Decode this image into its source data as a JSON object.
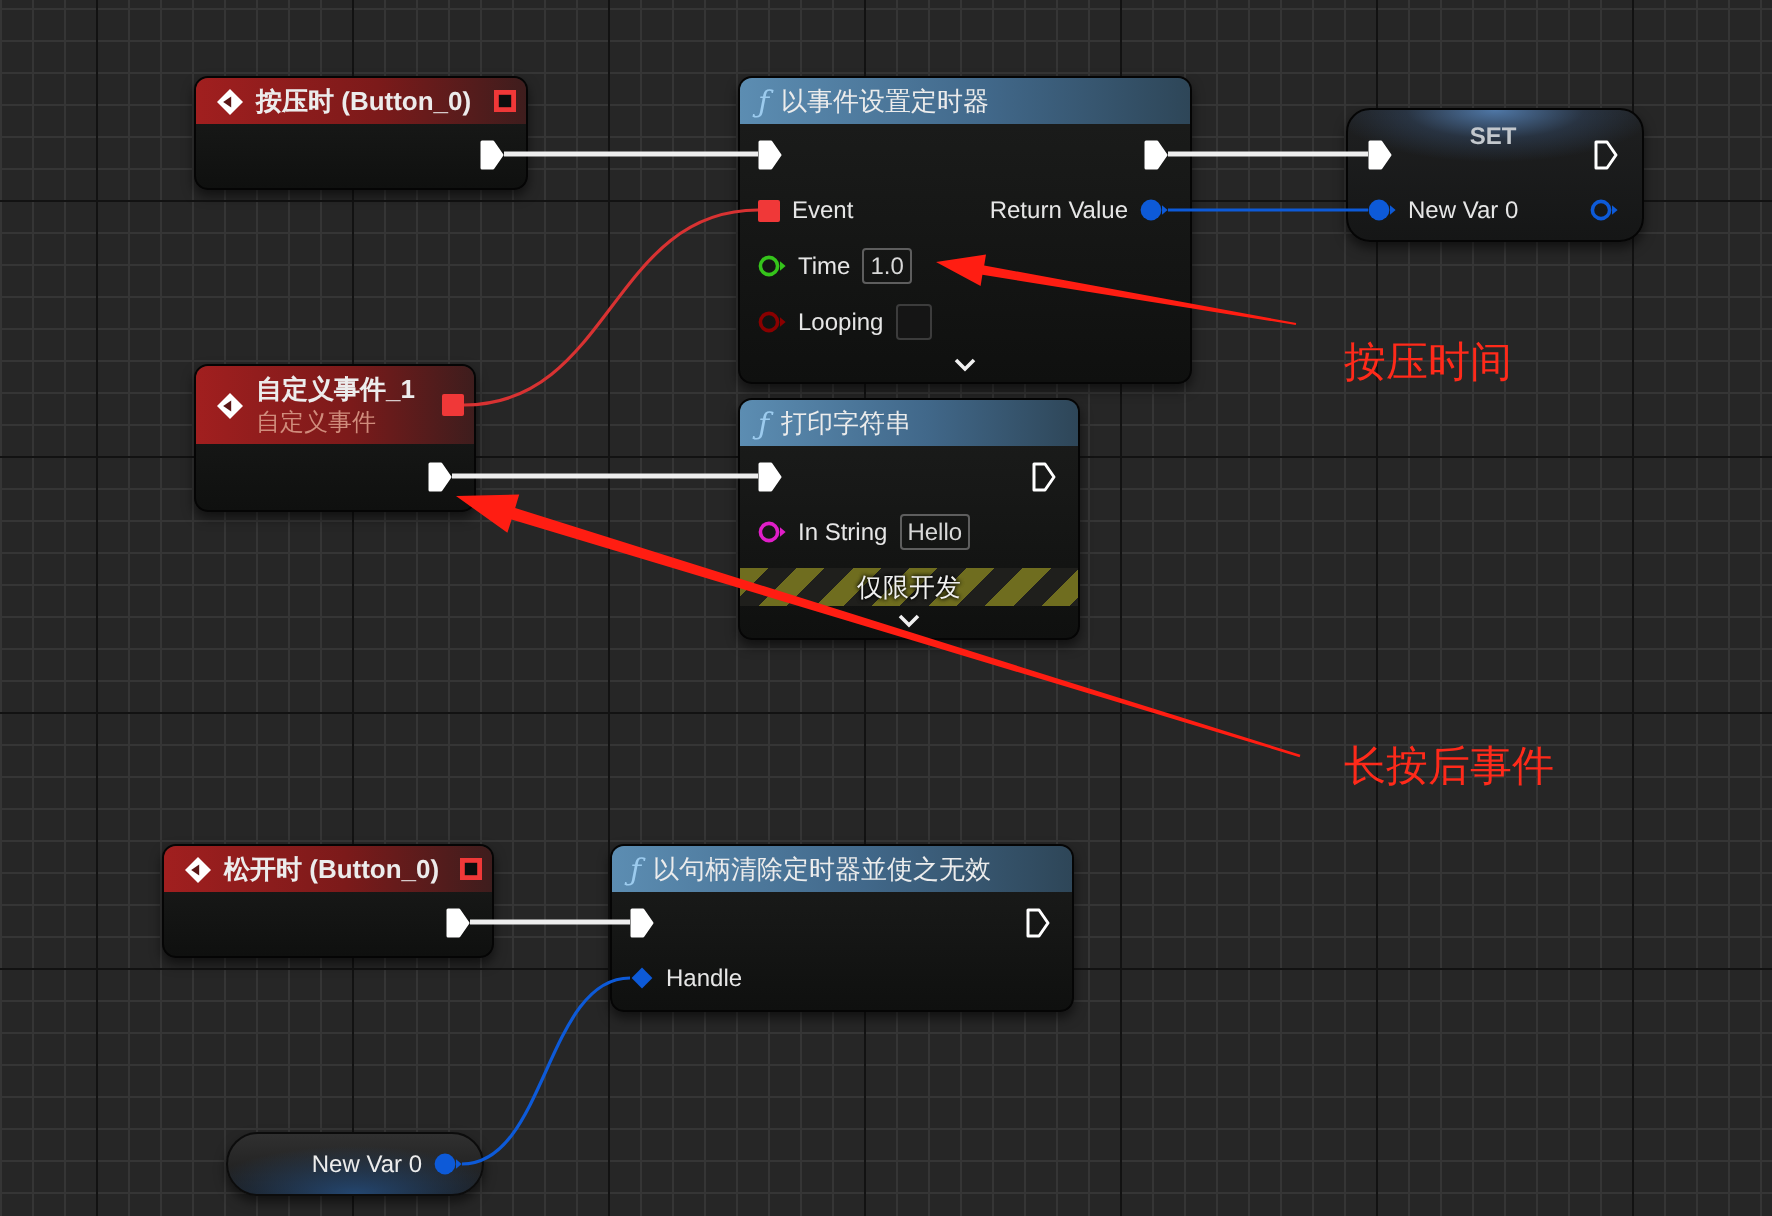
{
  "graph": {
    "nodes": [
      {
        "kind": "event",
        "title": "按压时 (Button_0)",
        "delegate": {
          "connected": false
        },
        "outputs": [
          {
            "kind": "exec",
            "connected": true
          }
        ]
      },
      {
        "kind": "function",
        "icon": "ƒ",
        "title": "以事件设置定时器",
        "inputs": [
          {
            "kind": "exec",
            "connected": true
          },
          {
            "kind": "delegate",
            "label": "Event",
            "connected": true
          },
          {
            "kind": "data",
            "label": "Time",
            "color": "#35c41b",
            "connected": false,
            "value": "1.0"
          },
          {
            "kind": "data",
            "label": "Looping",
            "color": "#8a0000",
            "connected": false,
            "checked": false
          }
        ],
        "outputs": [
          {
            "kind": "exec",
            "connected": true
          },
          {
            "kind": "data",
            "label": "Return Value",
            "color": "#0d5ad8",
            "connected": true
          }
        ],
        "expanded": false
      },
      {
        "kind": "set",
        "title": "SET",
        "inputs": [
          {
            "kind": "exec",
            "connected": true
          },
          {
            "kind": "data",
            "label": "New Var 0",
            "color": "#0d5ad8",
            "connected": true
          }
        ],
        "outputs": [
          {
            "kind": "exec",
            "connected": false
          },
          {
            "kind": "data",
            "color": "#0d5ad8",
            "connected": false
          }
        ]
      },
      {
        "kind": "event",
        "title": "自定义事件_1",
        "subtitle": "自定义事件",
        "delegate": {
          "connected": true
        },
        "outputs": [
          {
            "kind": "exec",
            "connected": true
          }
        ]
      },
      {
        "kind": "function",
        "icon": "ƒ",
        "title": "打印字符串",
        "inputs": [
          {
            "kind": "exec",
            "connected": true
          },
          {
            "kind": "data",
            "label": "In String",
            "color": "#e01ec8",
            "connected": false,
            "value": "Hello"
          }
        ],
        "outputs": [
          {
            "kind": "exec",
            "connected": false
          }
        ],
        "banner": "仅限开发",
        "expanded": false
      },
      {
        "kind": "event",
        "title": "松开时 (Button_0)",
        "delegate": {
          "connected": false
        },
        "outputs": [
          {
            "kind": "exec",
            "connected": true
          }
        ]
      },
      {
        "kind": "function",
        "icon": "ƒ",
        "title": "以句柄清除定时器並使之无效",
        "inputs": [
          {
            "kind": "exec",
            "connected": true
          },
          {
            "kind": "reference",
            "label": "Handle",
            "color": "#0d5ad8",
            "connected": true
          }
        ],
        "outputs": [
          {
            "kind": "exec",
            "connected": false
          }
        ]
      },
      {
        "kind": "getter",
        "title": "New Var 0",
        "outputs": [
          {
            "kind": "data",
            "color": "#0d5ad8",
            "connected": true
          }
        ]
      }
    ]
  },
  "annotations": [
    {
      "text": "按压时间"
    },
    {
      "text": "长按后事件"
    }
  ]
}
